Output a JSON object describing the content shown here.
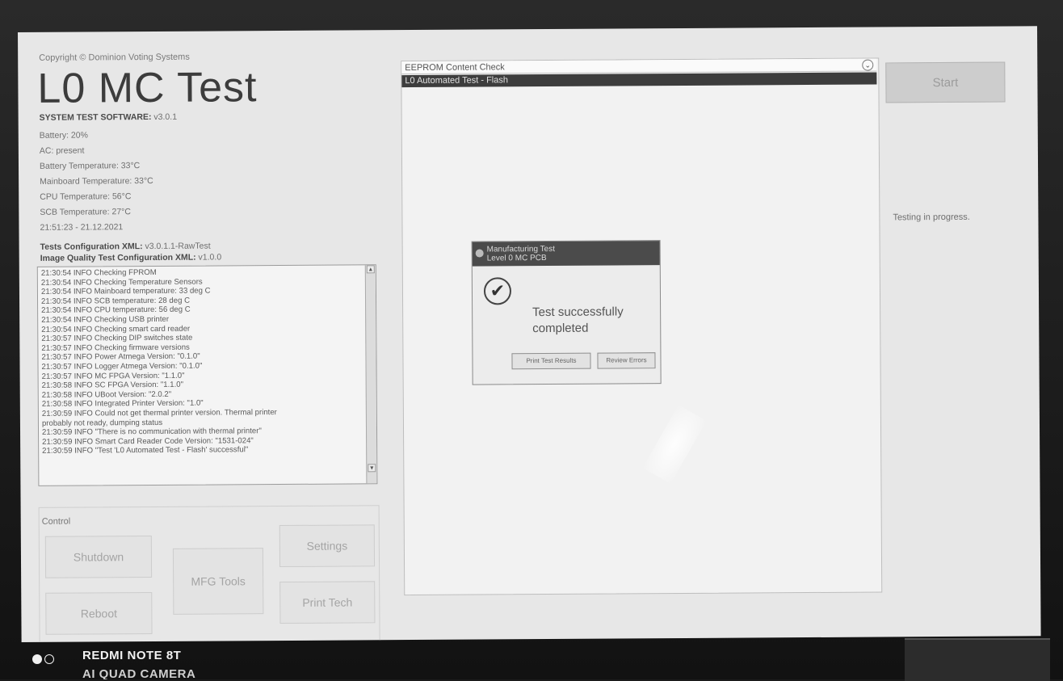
{
  "header": {
    "copyright": "Copyright © Dominion Voting Systems",
    "title": "L0 MC Test"
  },
  "system_info": [
    {
      "label": "SYSTEM TEST SOFTWARE:",
      "value": "v3.0.1"
    },
    {
      "label": "",
      "value": "Battery: 20%"
    },
    {
      "label": "",
      "value": "AC: present"
    },
    {
      "label": "",
      "value": "Battery Temperature: 33°C"
    },
    {
      "label": "",
      "value": "Mainboard Temperature: 33°C"
    },
    {
      "label": "",
      "value": "CPU Temperature: 56°C"
    },
    {
      "label": "",
      "value": "SCB Temperature: 27°C"
    },
    {
      "label": "",
      "value": "21:51:23 - 21.12.2021"
    },
    {
      "label": "Tests Configuration XML:",
      "value": "v3.0.1.1-RawTest"
    },
    {
      "label": "Image Quality Test Configuration XML:",
      "value": "v1.0.0"
    }
  ],
  "log_lines": [
    "21:30:54 INFO    Checking FPROM",
    "21:30:54 INFO    Checking Temperature Sensors",
    "21:30:54 INFO    Mainboard temperature: 33 deg C",
    "21:30:54 INFO    SCB temperature: 28 deg C",
    "21:30:54 INFO    CPU temperature: 56 deg C",
    "21:30:54 INFO    Checking USB printer",
    "21:30:54 INFO    Checking smart card reader",
    "21:30:57 INFO    Checking DIP switches state",
    "21:30:57 INFO    Checking firmware versions",
    "21:30:57 INFO    Power Atmega Version: \"0.1.0\"",
    "21:30:57 INFO    Logger Atmega Version: \"0.1.0\"",
    "21:30:57 INFO    MC FPGA Version: \"1.1.0\"",
    "21:30:58 INFO    SC FPGA Version: \"1.1.0\"",
    "21:30:58 INFO    UBoot Version: \"2.0.2\"",
    "21:30:58 INFO    Integrated Printer Version: \"1.0\"",
    "21:30:59 INFO    Could not get thermal printer version. Thermal printer",
    "probably not ready, dumping status",
    "21:30:59 INFO    \"There is no communication with thermal printer\"",
    "21:30:59 INFO    Smart Card Reader Code Version: \"1531-024\"",
    "21:30:59 INFO    \"Test 'L0 Automated Test - Flash' successful\""
  ],
  "control": {
    "label": "Control",
    "shutdown": "Shutdown",
    "reboot": "Reboot",
    "mfg_tools": "MFG Tools",
    "settings": "Settings",
    "print_tech": "Print Tech"
  },
  "test_list": {
    "dropdown_value": "EEPROM Content Check",
    "selected_item": "L0 Automated Test - Flash"
  },
  "dialog": {
    "title_line1": "Manufacturing Test",
    "title_line2": "Level 0 MC PCB",
    "message": "Test successfully completed",
    "print_button": "Print Test Results",
    "review_button": "Review Errors"
  },
  "right_panel": {
    "start_button": "Start",
    "status": "Testing in progress."
  },
  "camera_watermark": {
    "line1": "REDMI NOTE 8T",
    "line2": "AI QUAD CAMERA"
  }
}
